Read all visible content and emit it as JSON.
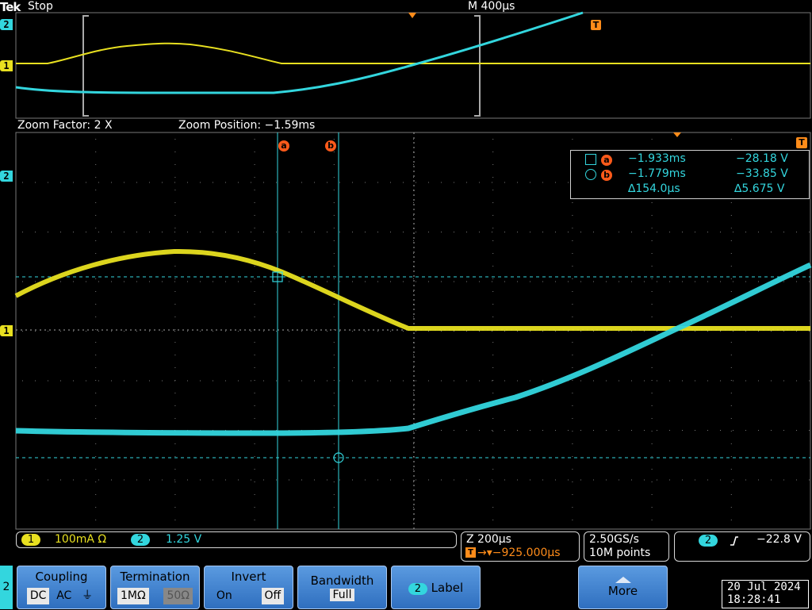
{
  "header": {
    "logo": "Tek",
    "run_state": "Stop",
    "timebase": "M 400μs"
  },
  "overview": {
    "trigger_label": "T"
  },
  "zoom": {
    "factor_text": "Zoom Factor: 2 X",
    "position_text": "Zoom Position: −1.59ms"
  },
  "channels": {
    "ch1": {
      "label": "1",
      "color": "#e8e020",
      "scale": "100mA Ω"
    },
    "ch2": {
      "label": "2",
      "color": "#33d6de",
      "scale": "1.25 V"
    }
  },
  "cursors": {
    "a": {
      "label": "a",
      "time": "−1.933ms",
      "value": "−28.18 V"
    },
    "b": {
      "label": "b",
      "time": "−1.779ms",
      "value": "−33.85 V"
    },
    "delta_time": "∆154.0μs",
    "delta_value": "∆5.675 V",
    "trigger_label": "T"
  },
  "horizontal": {
    "zoom_scale": "Z 200μs",
    "position": "→▾−925.000μs",
    "trigger_label": "T"
  },
  "acquisition": {
    "rate": "2.50GS/s",
    "points": "10M points"
  },
  "trigger": {
    "source": "2",
    "slope_icon": "rising-edge",
    "level": "−22.8 V"
  },
  "menu": {
    "side_tab": "2",
    "coupling": {
      "title": "Coupling",
      "options": [
        "DC",
        "AC",
        "⏚"
      ]
    },
    "termination": {
      "title": "Termination",
      "options": [
        "1MΩ",
        "50Ω"
      ]
    },
    "invert": {
      "title": "Invert",
      "options": [
        "On",
        "Off"
      ]
    },
    "bandwidth": {
      "title": "Bandwidth",
      "value": "Full"
    },
    "label": {
      "channel": "2",
      "title": "Label"
    },
    "more": {
      "title": "More"
    }
  },
  "datetime": {
    "date": "20 Jul  2024",
    "time": "18:28:41"
  }
}
